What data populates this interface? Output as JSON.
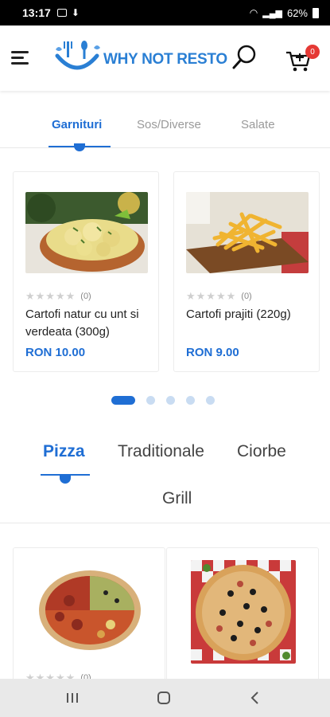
{
  "status_bar": {
    "time": "13:17",
    "battery": "62%"
  },
  "header": {
    "logo_text": "WHY NOT RESTO",
    "cart_count": "0"
  },
  "tabs_top": [
    {
      "label": "Garnituri",
      "active": true
    },
    {
      "label": "Sos/Diverse",
      "active": false
    },
    {
      "label": "Salate",
      "active": false
    }
  ],
  "products_top": [
    {
      "title": "Cartofi natur cu unt si verdeata (300g)",
      "price": "RON 10.00",
      "rating_count": "(0)",
      "image": "boiled-potatoes-dill"
    },
    {
      "title": "Cartofi prajiti (220g)",
      "price": "RON 9.00",
      "rating_count": "(0)",
      "image": "french-fries-board"
    }
  ],
  "carousel": {
    "pages": 5,
    "active_index": 0
  },
  "tabs_bottom": [
    {
      "label": "Pizza",
      "active": true
    },
    {
      "label": "Traditionale",
      "active": false
    },
    {
      "label": "Ciorbe",
      "active": false
    },
    {
      "label": "Grill",
      "active": false
    }
  ],
  "products_bottom": [
    {
      "rating_count": "(0)",
      "image": "pizza-quattro-stagioni"
    },
    {
      "image": "pizza-olives-ham"
    }
  ],
  "colors": {
    "accent": "#1f6ed4",
    "badge": "#e53935",
    "logo": "#2a7fd4"
  }
}
